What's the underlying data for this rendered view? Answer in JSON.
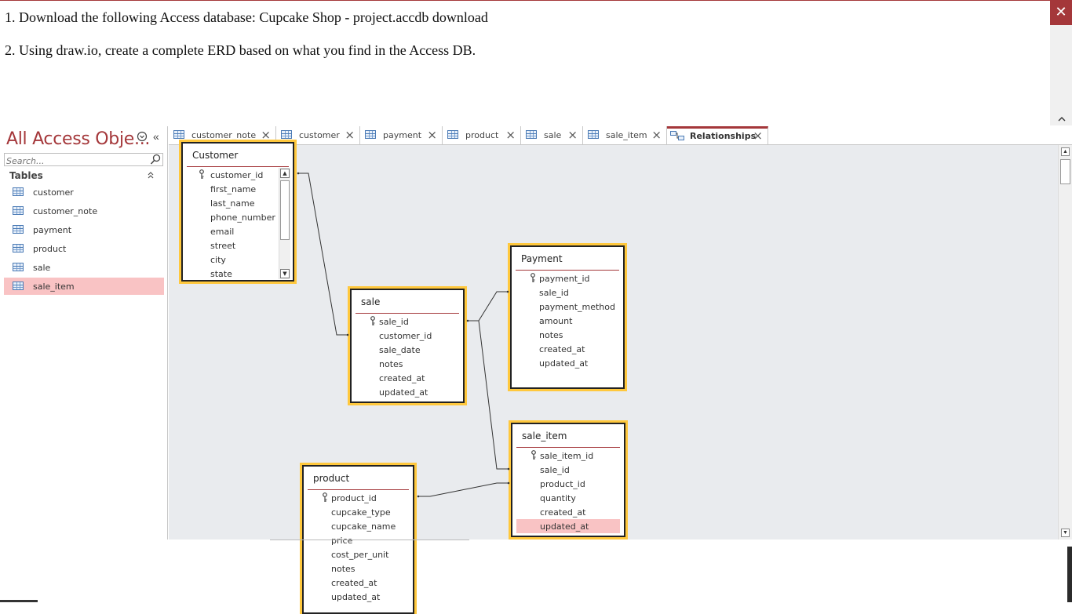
{
  "instructions": {
    "step1": "1. Download the following Access database: Cupcake Shop - project.accdb download",
    "step2": "2. Using draw.io, create a complete ERD based on what you find in the Access DB."
  },
  "window": {
    "close_glyph": "✕",
    "collapse_glyph": "^"
  },
  "nav": {
    "title": "All Access Obje...",
    "menu_glyph": "⊙",
    "shutter_glyph": "«",
    "search_placeholder": "Search...",
    "group_label": "Tables",
    "group_glyph": "⌃",
    "items": [
      {
        "label": "customer",
        "selected": false
      },
      {
        "label": "customer_note",
        "selected": false
      },
      {
        "label": "payment",
        "selected": false
      },
      {
        "label": "product",
        "selected": false
      },
      {
        "label": "sale",
        "selected": false
      },
      {
        "label": "sale_item",
        "selected": true
      }
    ]
  },
  "tabs": [
    {
      "label": "customer_note",
      "active": false
    },
    {
      "label": "customer",
      "active": false
    },
    {
      "label": "payment",
      "active": false
    },
    {
      "label": "product",
      "active": false
    },
    {
      "label": "sale",
      "active": false
    },
    {
      "label": "sale_item",
      "active": false
    },
    {
      "label": "Relationships",
      "active": true
    }
  ],
  "tab_close_glyph": "×",
  "tables": {
    "customer": {
      "title": "Customer",
      "fields": [
        "customer_id",
        "first_name",
        "last_name",
        "phone_number",
        "email",
        "street",
        "city",
        "state"
      ],
      "key": "customer_id"
    },
    "sale": {
      "title": "sale",
      "fields": [
        "sale_id",
        "customer_id",
        "sale_date",
        "notes",
        "created_at",
        "updated_at"
      ],
      "key": "sale_id"
    },
    "payment": {
      "title": "Payment",
      "fields": [
        "payment_id",
        "sale_id",
        "payment_method",
        "amount",
        "notes",
        "created_at",
        "updated_at"
      ],
      "key": "payment_id"
    },
    "sale_item": {
      "title": "sale_item",
      "fields": [
        "sale_item_id",
        "sale_id",
        "product_id",
        "quantity",
        "created_at",
        "updated_at"
      ],
      "key": "sale_item_id",
      "selected_field": "updated_at"
    },
    "product": {
      "title": "product",
      "fields": [
        "product_id",
        "cupcake_type",
        "cupcake_name",
        "price",
        "cost_per_unit",
        "notes",
        "created_at",
        "updated_at"
      ],
      "key": "product_id"
    }
  },
  "relationships": [
    {
      "from": "customer.customer_id",
      "to": "sale.customer_id"
    },
    {
      "from": "sale.sale_id",
      "to": "payment.sale_id"
    },
    {
      "from": "sale.sale_id",
      "to": "sale_item.sale_id"
    },
    {
      "from": "product.product_id",
      "to": "sale_item.product_id"
    }
  ],
  "colors": {
    "accent": "#a4373a",
    "selection": "#f9c3c4",
    "table_highlight": "#ffc83d",
    "canvas": "#e9ebee"
  }
}
